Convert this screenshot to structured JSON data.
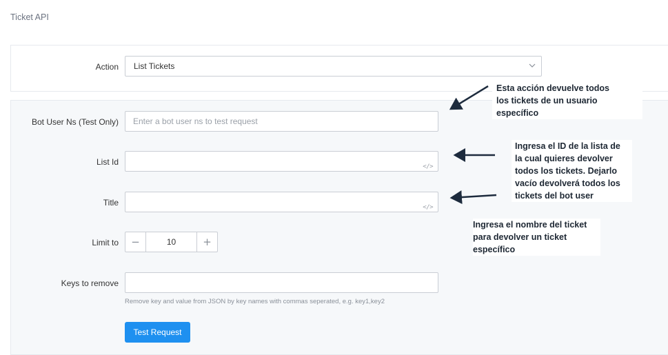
{
  "page": {
    "title": "Ticket API"
  },
  "action": {
    "label": "Action",
    "selected": "List Tickets"
  },
  "fields": {
    "bot_user_ns": {
      "label": "Bot User Ns (Test Only)",
      "value": "",
      "placeholder": "Enter a bot user ns to test request"
    },
    "list_id": {
      "label": "List Id",
      "value": "",
      "placeholder": ""
    },
    "title": {
      "label": "Title",
      "value": "",
      "placeholder": ""
    },
    "limit_to": {
      "label": "Limit to",
      "value": "10",
      "minus": "−",
      "plus": "+"
    },
    "keys_to_remove": {
      "label": "Keys to remove",
      "value": "",
      "placeholder": "",
      "help": "Remove key and value from JSON by key names with commas seperated, e.g. key1,key2"
    }
  },
  "code_icon": "</>",
  "buttons": {
    "test_request": "Test Request"
  },
  "annotations": {
    "action_note": [
      "Esta acción devuelve todos",
      "los tickets de un usuario",
      "específico"
    ],
    "list_id_note": [
      "Ingresa el ID de la lista de",
      "la cual quieres devolver",
      "todos los tickets. Dejarlo",
      "vacío devolverá todos los",
      "tickets del bot user"
    ],
    "title_note": [
      "Ingresa el nombre del ticket",
      "para devolver un ticket",
      "específico"
    ]
  },
  "colors": {
    "primary": "#1e90f0",
    "arrow": "#1d2b3d"
  }
}
